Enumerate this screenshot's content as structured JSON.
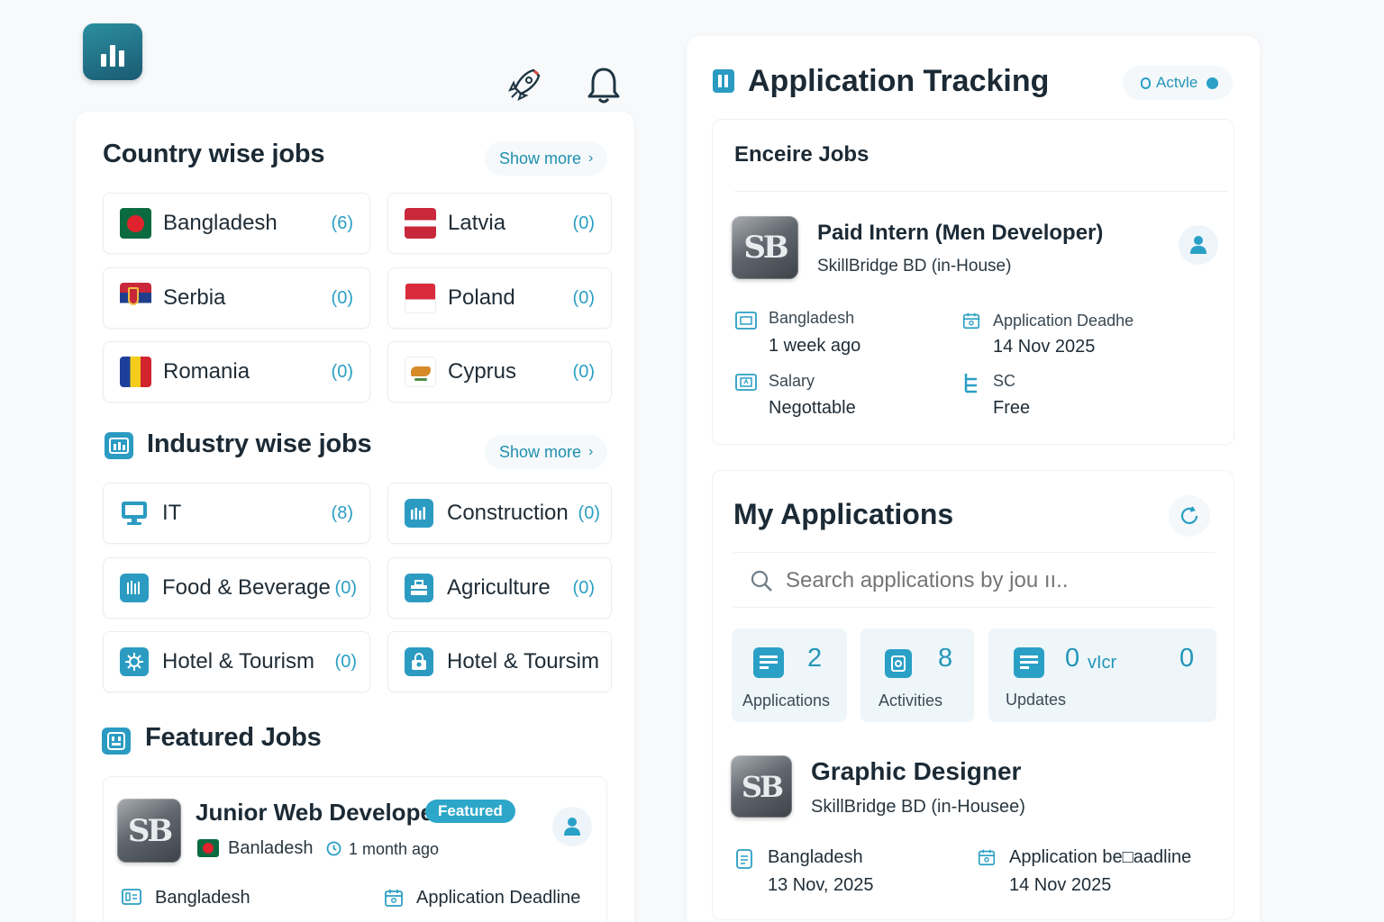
{
  "header": {
    "logo_icon": "bar-chart-logo-icon",
    "icons": [
      "rocket-icon",
      "bell-icon"
    ]
  },
  "country_section": {
    "title": "Country wise jobs",
    "show_more": "Show more",
    "items": [
      {
        "name": "Bangladesh",
        "count": "(6)"
      },
      {
        "name": "Latvia",
        "count": "(0)"
      },
      {
        "name": "Serbia",
        "count": "(0)"
      },
      {
        "name": "Poland",
        "count": "(0)"
      },
      {
        "name": "Romania",
        "count": "(0)"
      },
      {
        "name": "Cyprus",
        "count": "(0)"
      }
    ]
  },
  "industry_section": {
    "title": "Industry wise jobs",
    "show_more": "Show more",
    "items": [
      {
        "name": "IT",
        "count": "(8)"
      },
      {
        "name": "Construction",
        "count": "(0)"
      },
      {
        "name": "Food & Beverage",
        "count": "(0)"
      },
      {
        "name": "Agriculture",
        "count": "(0)"
      },
      {
        "name": "Hotel & Tourism",
        "count": "(0)"
      },
      {
        "name": "Hotel & Toursim",
        "count": ""
      }
    ]
  },
  "featured_section": {
    "title": "Featured Jobs",
    "job": {
      "logo": "SB",
      "title": "Junior Web Developer",
      "badge": "Featured",
      "country": "Banladesh",
      "posted": "1 month ago",
      "meta_left_label": "Bangladesh",
      "meta_right_label": "Application Deadline"
    }
  },
  "tracking": {
    "title": "Application Tracking",
    "status": "Actvle",
    "card_title": "Enceire Jobs",
    "job": {
      "logo": "SB",
      "title": "Paid Intern (Men Developer)",
      "company": "SkillBridge BD (in-House)",
      "meta": [
        {
          "label": "Bangladesh",
          "value": "1 week ago",
          "icon": "location-card-icon"
        },
        {
          "label": "Application Deadhe",
          "value": "14 Nov 2025",
          "icon": "calendar-icon"
        },
        {
          "label": "Salary",
          "value": "Negottable",
          "icon": "salary-icon"
        },
        {
          "label": "SC",
          "value": "Free",
          "icon": "fee-icon"
        }
      ]
    }
  },
  "my_applications": {
    "title": "My Applications",
    "search_placeholder": "Search applications by jou ıı..",
    "stats": [
      {
        "value": "2",
        "label": "Applications",
        "icon": "applications-icon"
      },
      {
        "value": "8",
        "label": "Activities",
        "icon": "activities-icon"
      },
      {
        "value": "0",
        "extra": "vIcr",
        "value2": "0",
        "label": "Updates",
        "icon": "updates-icon"
      }
    ],
    "job": {
      "logo": "SB",
      "title": "Graphic Designer",
      "company": "SkillBridge BD (in-Housee)",
      "meta": [
        {
          "label": "Bangladesh",
          "value": "13 Nov, 2025",
          "icon": "document-icon"
        },
        {
          "label": "Application be□aadline",
          "value": "14 Nov 2025",
          "icon": "calendar-icon"
        }
      ]
    }
  }
}
